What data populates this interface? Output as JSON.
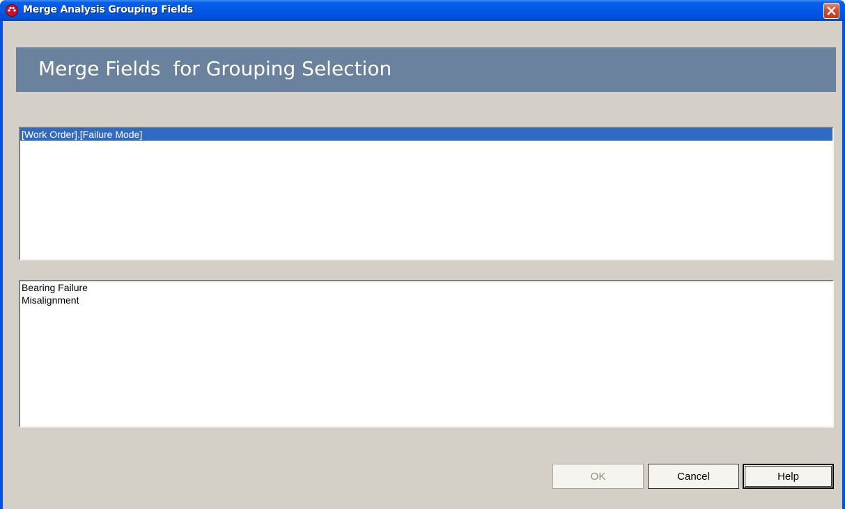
{
  "window": {
    "title": "Merge Analysis Grouping Fields",
    "title_bar_color": "#0054e3"
  },
  "header": {
    "title": "Merge Fields  for Grouping Selection",
    "band_color": "#6b829f"
  },
  "fields_list": {
    "items": [
      {
        "label": "[Work Order].[Failure Mode]",
        "selected": true
      }
    ],
    "selection_color": "#316ac5"
  },
  "values_list": {
    "items": [
      {
        "label": "Bearing Failure"
      },
      {
        "label": "Misalignment"
      }
    ]
  },
  "buttons": {
    "ok": {
      "label": "OK",
      "enabled": false
    },
    "cancel": {
      "label": "Cancel",
      "enabled": true
    },
    "help": {
      "label": "Help",
      "enabled": true,
      "default": true
    }
  },
  "icons": {
    "app": "red-dots-app-icon",
    "close": "close-x-icon"
  }
}
